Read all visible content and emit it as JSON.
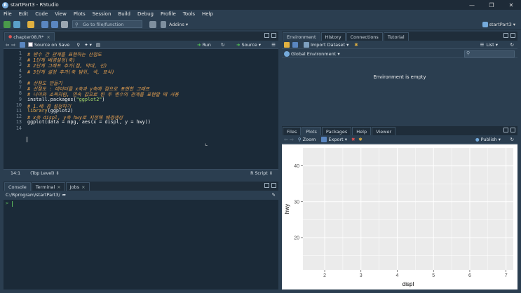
{
  "window": {
    "title": "startPart3 - RStudio"
  },
  "menu": [
    "File",
    "Edit",
    "Code",
    "View",
    "Plots",
    "Session",
    "Build",
    "Debug",
    "Profile",
    "Tools",
    "Help"
  ],
  "toolbar": {
    "goto_placeholder": "Go to file/function",
    "addins": "Addins",
    "project": "startPart3"
  },
  "editor": {
    "tab": "chapter08.R*",
    "source_on_save": "Source on Save",
    "run": "Run",
    "source": "Source",
    "lines": [
      {
        "n": "1",
        "segments": [
          {
            "t": "# 변수 간 관계를 표현하는 산점도",
            "c": "c-com"
          }
        ]
      },
      {
        "n": "2",
        "segments": [
          {
            "t": "# 1단계 배경설정(축)",
            "c": "c-com"
          }
        ]
      },
      {
        "n": "3",
        "segments": [
          {
            "t": "# 2단계 그래프 추가(점, 막대, 선)",
            "c": "c-com"
          }
        ]
      },
      {
        "n": "4",
        "segments": [
          {
            "t": "# 3단계 설정 추가(축 범위, 색, 표식)",
            "c": "c-com"
          }
        ]
      },
      {
        "n": "5",
        "segments": []
      },
      {
        "n": "6",
        "segments": [
          {
            "t": "# 산점도 만들기",
            "c": "c-com"
          }
        ]
      },
      {
        "n": "7",
        "segments": [
          {
            "t": "# 산점도 : 데이터를 x축과 y축에 점으로 표현한 그래프",
            "c": "c-com"
          }
        ]
      },
      {
        "n": "8",
        "segments": [
          {
            "t": "# 나이와 소득처럼, 연속 값으로 된 두 변수의 관계를 표현할 때 사용",
            "c": "c-com"
          }
        ]
      },
      {
        "n": "9",
        "segments": [
          {
            "t": "install.packages(",
            "c": "c-def"
          },
          {
            "t": "\"ggplot2\"",
            "c": "c-str"
          },
          {
            "t": ")",
            "c": "c-def"
          }
        ]
      },
      {
        "n": "10",
        "segments": [
          {
            "t": "# 1.배 경 설정하기",
            "c": "c-com"
          }
        ]
      },
      {
        "n": "11",
        "segments": [
          {
            "t": "library",
            "c": "c-lib"
          },
          {
            "t": "(ggplot2)",
            "c": "c-def"
          }
        ]
      },
      {
        "n": "12",
        "segments": [
          {
            "t": "# x축 displ, y축 hwy로 지정해 배경생성",
            "c": "c-com"
          }
        ]
      },
      {
        "n": "13",
        "segments": [
          {
            "t": "ggplot(data = mpg, aes(x = displ, y = hwy))",
            "c": "c-def"
          }
        ]
      },
      {
        "n": "14",
        "segments": []
      }
    ],
    "status_pos": "14:1",
    "status_scope": "(Top Level)",
    "status_lang": "R Script"
  },
  "console": {
    "tabs": [
      "Console",
      "Terminal",
      "Jobs"
    ],
    "path": "C:/Rprogram/startPart3/",
    "prompt": ">"
  },
  "env": {
    "tabs": [
      "Environment",
      "History",
      "Connections",
      "Tutorial"
    ],
    "import_dataset": "Import Dataset",
    "list": "List",
    "global_env": "Global Environment",
    "empty_msg": "Environment is empty"
  },
  "plots": {
    "tabs": [
      "Files",
      "Plots",
      "Packages",
      "Help",
      "Viewer"
    ],
    "zoom": "Zoom",
    "export": "Export",
    "publish": "Publish"
  },
  "chart_data": {
    "type": "scatter",
    "xlabel": "displ",
    "ylabel": "hwy",
    "x_ticks": [
      2,
      3,
      4,
      5,
      6,
      7
    ],
    "y_ticks": [
      20,
      30,
      40
    ],
    "xlim": [
      1.4,
      7.2
    ],
    "ylim": [
      11,
      45
    ],
    "points": [],
    "grid": true,
    "colors": {
      "panel": "#ebebeb",
      "grid": "#ffffff"
    }
  }
}
